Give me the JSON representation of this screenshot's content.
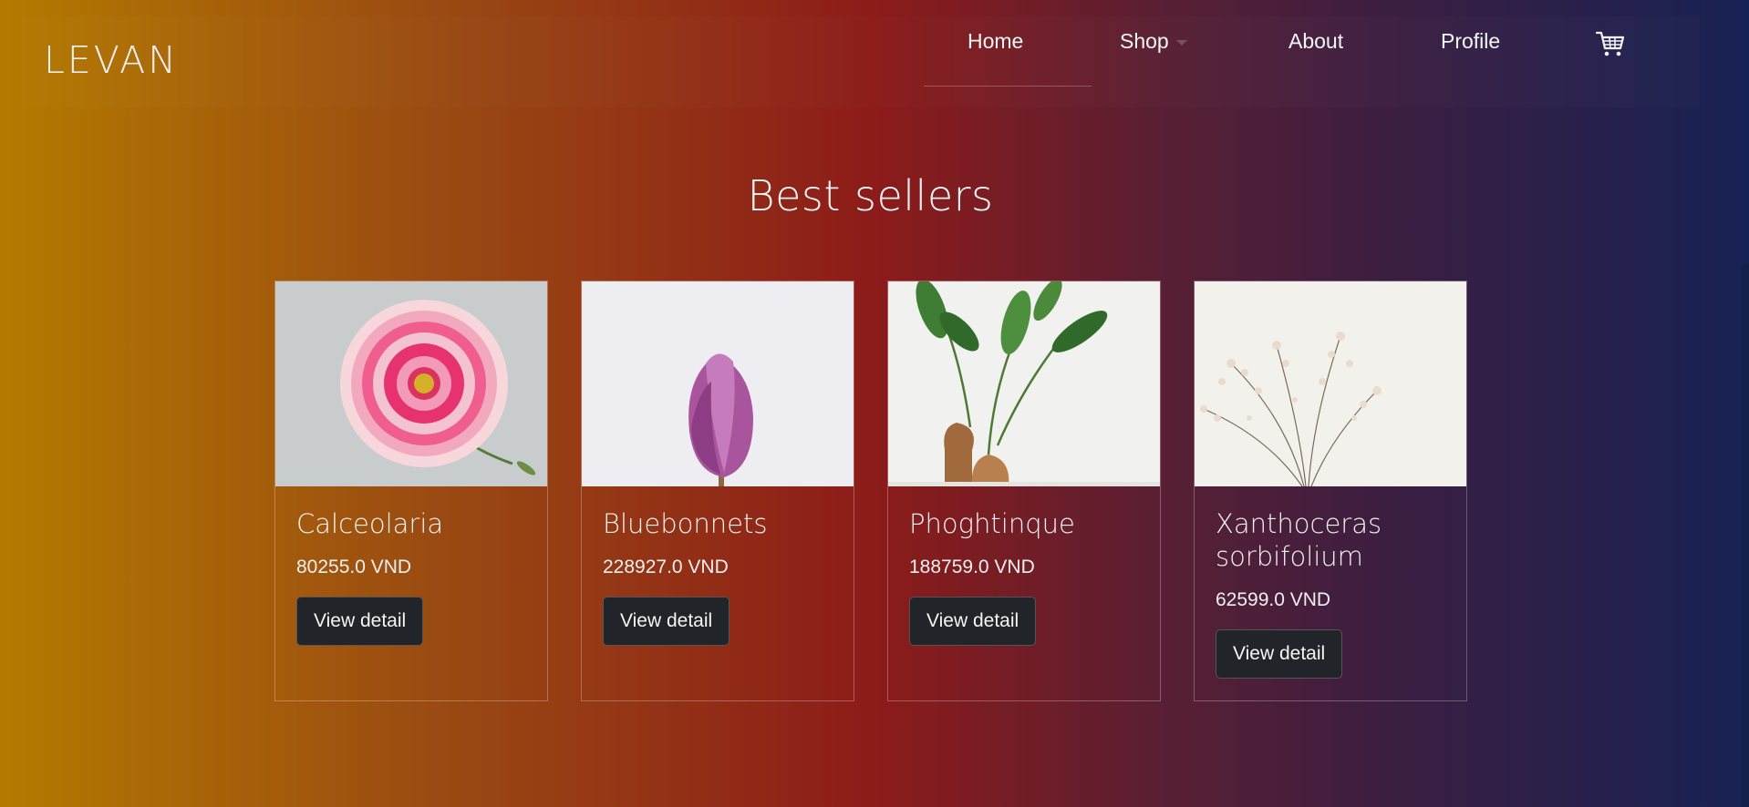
{
  "brand": "LEVAN",
  "nav": {
    "home": "Home",
    "shop": "Shop",
    "about": "About",
    "profile": "Profile",
    "cart_icon": "cart-icon"
  },
  "section_title": "Best sellers",
  "products": [
    {
      "name": "Calceolaria",
      "price": "80255.0 VND",
      "button": "View detail",
      "image": "pink-dahlia-flower"
    },
    {
      "name": "Bluebonnets",
      "price": "228927.0 VND",
      "button": "View detail",
      "image": "purple-magnolia-bud"
    },
    {
      "name": "Phoghtinque",
      "price": "188759.0 VND",
      "button": "View detail",
      "image": "plants-in-wooden-vases"
    },
    {
      "name": "Xanthoceras sorbifolium",
      "price": "62599.0 VND",
      "button": "View detail",
      "image": "dried-white-blossom-branches"
    }
  ],
  "colors": {
    "gradient_start": "#b47a00",
    "gradient_mid": "#8c1b19",
    "gradient_end": "#172254",
    "button_bg": "#212529"
  }
}
